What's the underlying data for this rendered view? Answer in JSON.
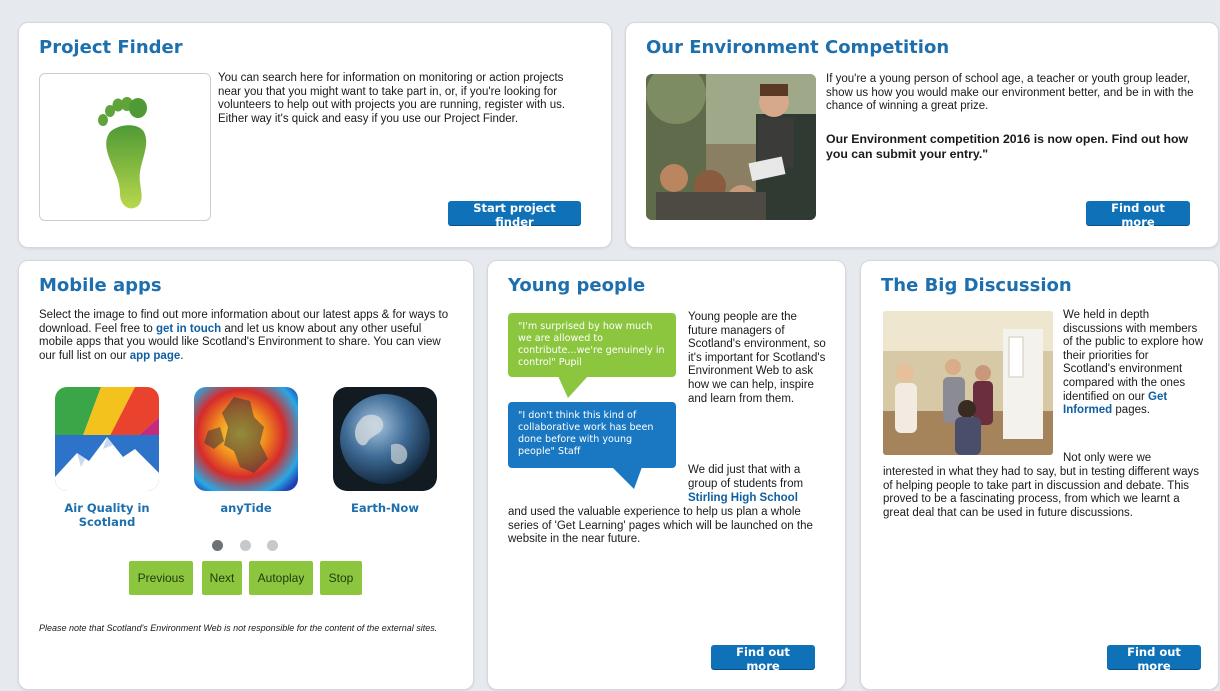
{
  "project_finder": {
    "title": "Project Finder",
    "body": "You can search here for information on monitoring or action projects near you that you might want to take part in, or, if you're looking for volunteers to help out with projects you are running, register with us. Either way it's quick and easy if you use our Project Finder.",
    "button": "Start project finder",
    "icon": "footprint-icon"
  },
  "competition": {
    "title": "Our Environment Competition",
    "body": "If you're a young person of school age, a teacher or youth group leader, show us how you would make our environment better, and be in with the chance of winning a great prize.",
    "highlight": "Our Environment competition 2016 is now open. Find out how you can submit your entry.\"",
    "button": "Find out more"
  },
  "mobile_apps": {
    "title": "Mobile apps",
    "intro_1": "Select the image to find out more information about our latest apps & for ways to download. Feel free to ",
    "link_touch": "get in touch",
    "intro_2": " and let us know about any other useful mobile apps that you would like Scotland's Environment to share. You can view our full list on our ",
    "link_app_page": "app page",
    "intro_3": ".",
    "apps": [
      {
        "label": "Air Quality in Scotland"
      },
      {
        "label": "anyTide"
      },
      {
        "label": "Earth-Now"
      }
    ],
    "controls": {
      "previous": "Previous",
      "next": "Next",
      "autoplay": "Autoplay",
      "stop": "Stop"
    },
    "disclaimer": "Please note that Scotland's Environment Web is not responsible for the content of the external sites."
  },
  "young_people": {
    "title": "Young people",
    "quote_1": "\"I'm surprised by how much we are allowed to contribute...we're genuinely in control\"   Pupil",
    "quote_2": "\"I don't think this kind of collaborative work has been done before with young people\"   Staff",
    "para_1": "Young people are the future managers of Scotland's environment, so it's important for Scotland's Environment Web to ask how we can help, inspire and learn from them.",
    "para_2a": "We did just that with a group of students from",
    "link_school": "Stirling High School",
    "para_2b": "and used the valuable experience to help us plan a whole series of 'Get Learning' pages which will be launched on the website in the near future.",
    "button": "Find out more"
  },
  "big_discussion": {
    "title": "The Big Discussion",
    "para_1a": "We held in depth discussions with members of the public to explore how their priorities for Scotland's environment compared with the ones identified on our ",
    "link_informed": "Get Informed",
    "para_1b": " pages.",
    "para_2_indent": "Not only were we",
    "para_2": "interested in what they had to say, but in testing different ways of helping people to take part in discussion and debate. This proved to be a fascinating process, from which we learnt a great deal that can be used in future discussions.",
    "button": "Find out more"
  },
  "colors": {
    "accent": "#1d6fae",
    "button_blue": "#0f71b8",
    "button_green": "#8cc63f",
    "quote_green": "#8cc63f",
    "quote_blue": "#1a78c2"
  }
}
